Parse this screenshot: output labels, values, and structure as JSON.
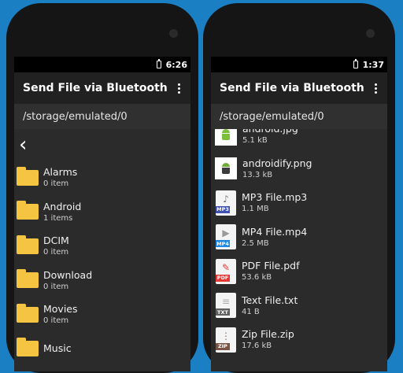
{
  "left": {
    "status": {
      "time": "6:26"
    },
    "appbar": {
      "title": "Send File via Bluetooth"
    },
    "path": "/storage/emulated/0",
    "folders": [
      {
        "name": "Alarms",
        "sub": "0 item"
      },
      {
        "name": "Android",
        "sub": "1 items"
      },
      {
        "name": "DCIM",
        "sub": "0 item"
      },
      {
        "name": "Download",
        "sub": "0 item"
      },
      {
        "name": "Movies",
        "sub": "0 item"
      },
      {
        "name": "Music",
        "sub": ""
      }
    ]
  },
  "right": {
    "status": {
      "time": "1:37"
    },
    "appbar": {
      "title": "Send File via Bluetooth"
    },
    "path": "/storage/emulated/0",
    "files": [
      {
        "name": "android.jpg",
        "size": "5.1 kB",
        "icon": "android-image-thumb"
      },
      {
        "name": "androidify.png",
        "size": "13.3 kB",
        "icon": "androidify-image-thumb"
      },
      {
        "name": "MP3 File.mp3",
        "size": "1.1 MB",
        "icon": "music-file-icon",
        "tag": "MP3",
        "tag_color": "#3f51b5"
      },
      {
        "name": "MP4 File.mp4",
        "size": "2.5 MB",
        "icon": "video-file-icon",
        "tag": "MP4",
        "tag_color": "#1e88e5"
      },
      {
        "name": "PDF File.pdf",
        "size": "53.6 kB",
        "icon": "pdf-file-icon",
        "tag": "PDF",
        "tag_color": "#e53935"
      },
      {
        "name": "Text File.txt",
        "size": "41 B",
        "icon": "text-file-icon",
        "tag": "TXT",
        "tag_color": "#616161"
      },
      {
        "name": "Zip File.zip",
        "size": "17.6 kB",
        "icon": "zip-file-icon",
        "tag": "ZIP",
        "tag_color": "#795548"
      }
    ]
  }
}
